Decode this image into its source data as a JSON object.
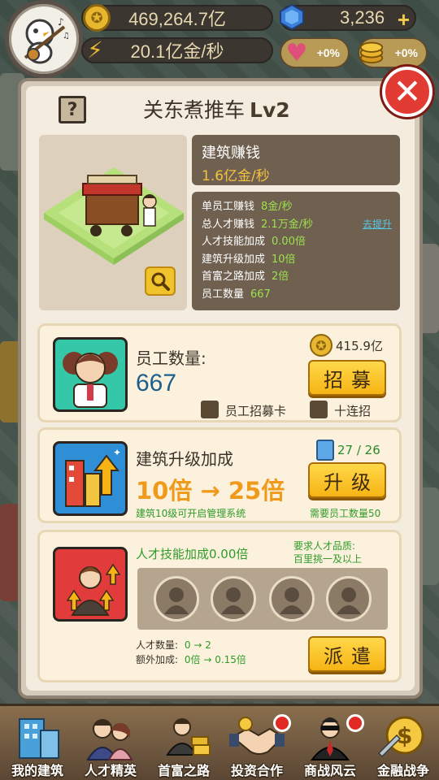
{
  "hud": {
    "gold_amount": "469,264.7亿",
    "gold_rate": "20.1亿金/秒",
    "gems": "3,236",
    "boost_heart": "+0%",
    "boost_coin": "+0%"
  },
  "modal": {
    "help_label": "?",
    "close_label": "✕",
    "title": "关东煮推车",
    "level": "Lv2"
  },
  "building": {
    "earn_title": "建筑赚钱",
    "earn_value": "1.6亿金/秒",
    "stats": [
      {
        "label": "单员工赚钱",
        "value": "8金/秒"
      },
      {
        "label": "总人才赚钱",
        "value": "2.1万金/秒"
      },
      {
        "label": "人才技能加成",
        "value": "0.00倍"
      },
      {
        "label": "建筑升级加成",
        "value": "10倍"
      },
      {
        "label": "首富之路加成",
        "value": "2倍"
      },
      {
        "label": "员工数量",
        "value": "667"
      }
    ],
    "upgrade_link": "去提升"
  },
  "staff_card": {
    "label": "员工数量:",
    "count": "667",
    "cost": "415.9亿",
    "recruit_button": "招募",
    "option_card": "员工招募卡",
    "option_ten": "十连招"
  },
  "upgrade_card": {
    "label": "建筑升级加成",
    "from_to": "10倍 → 25倍",
    "progress_text": "27 / 26",
    "upgrade_button": "升级",
    "hint_left": "建筑10级可开启管理系统",
    "hint_right": "需要员工数量50"
  },
  "talent_card": {
    "skill_bonus": "人才技能加成0.00倍",
    "req_title": "要求人才品质:",
    "req_value": "百里挑一及以上",
    "talent_count_label": "人才数量:",
    "talent_count_value": "0 → 2",
    "extra_bonus_label": "额外加成:",
    "extra_bonus_value": "0倍 → 0.15倍",
    "dispatch_button": "派遣",
    "slots": 4
  },
  "bottom_nav": [
    {
      "label": "我的建筑",
      "icon": "building-icon"
    },
    {
      "label": "人才精英",
      "icon": "elite-icon"
    },
    {
      "label": "首富之路",
      "icon": "rich-road-icon"
    },
    {
      "label": "投资合作",
      "icon": "handshake-icon"
    },
    {
      "label": "商战风云",
      "icon": "business-war-icon"
    },
    {
      "label": "金融战争",
      "icon": "finance-war-icon"
    }
  ],
  "colors": {
    "accent_gold": "#f6b414",
    "value_green": "#9ce24e",
    "link_cyan": "#58c7e4",
    "orange_text": "#f09a1c",
    "close_red": "#e23b33"
  }
}
